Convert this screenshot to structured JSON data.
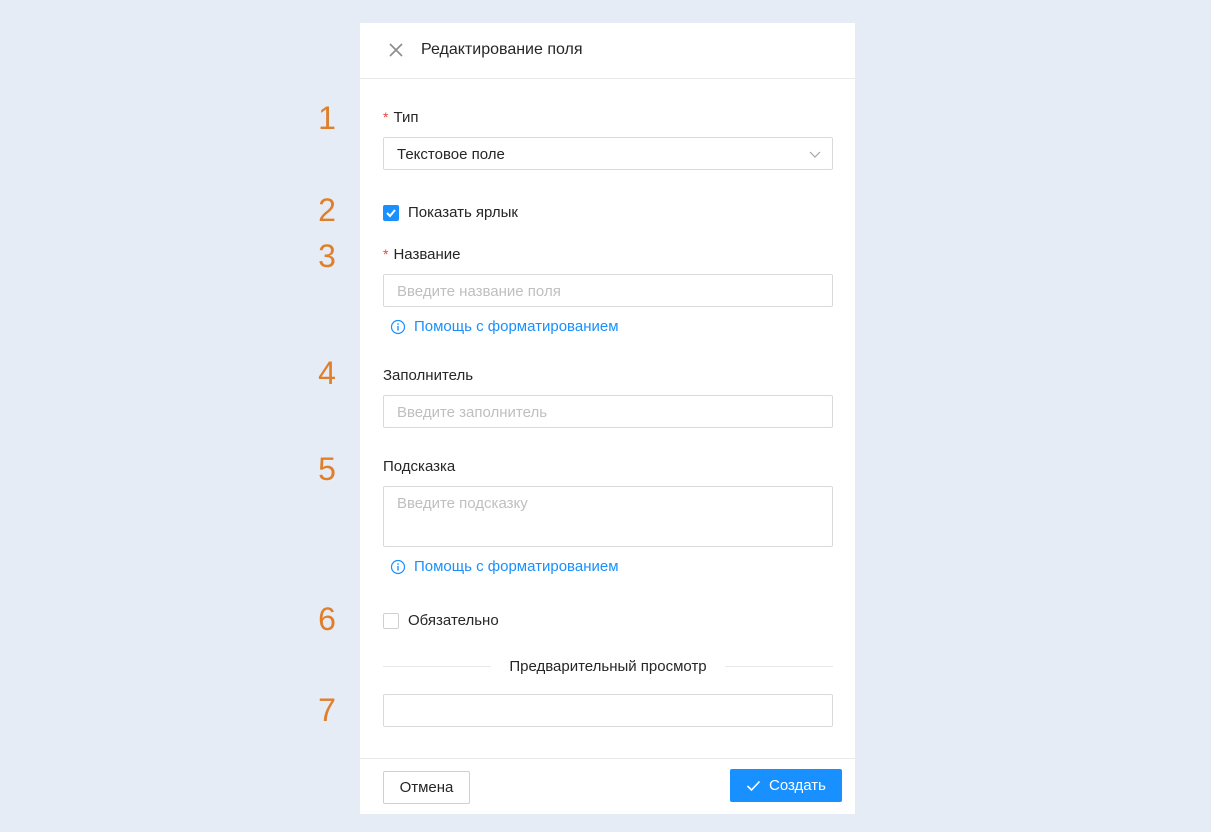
{
  "callouts": [
    "1",
    "2",
    "3",
    "4",
    "5",
    "6",
    "7"
  ],
  "dialog": {
    "title": "Редактирование поля",
    "type_field": {
      "required_mark": "*",
      "label": "Тип",
      "value": "Текстовое поле"
    },
    "show_label": {
      "label": "Показать ярлык",
      "checked": true
    },
    "name_field": {
      "required_mark": "*",
      "label": "Название",
      "placeholder": "Введите название поля",
      "help_link": "Помощь с форматированием"
    },
    "placeholder_field": {
      "label": "Заполнитель",
      "placeholder": "Введите заполнитель"
    },
    "hint_field": {
      "label": "Подсказка",
      "placeholder": "Введите подсказку",
      "help_link": "Помощь с форматированием"
    },
    "required": {
      "label": "Обязательно",
      "checked": false
    },
    "preview": {
      "divider_label": "Предварительный просмотр"
    },
    "footer": {
      "cancel_label": "Отмена",
      "create_label": "Создать"
    }
  },
  "colors": {
    "background": "#e5ecf6",
    "accent": "#1890ff",
    "callout": "#e07f2b",
    "required": "#e8463d"
  }
}
